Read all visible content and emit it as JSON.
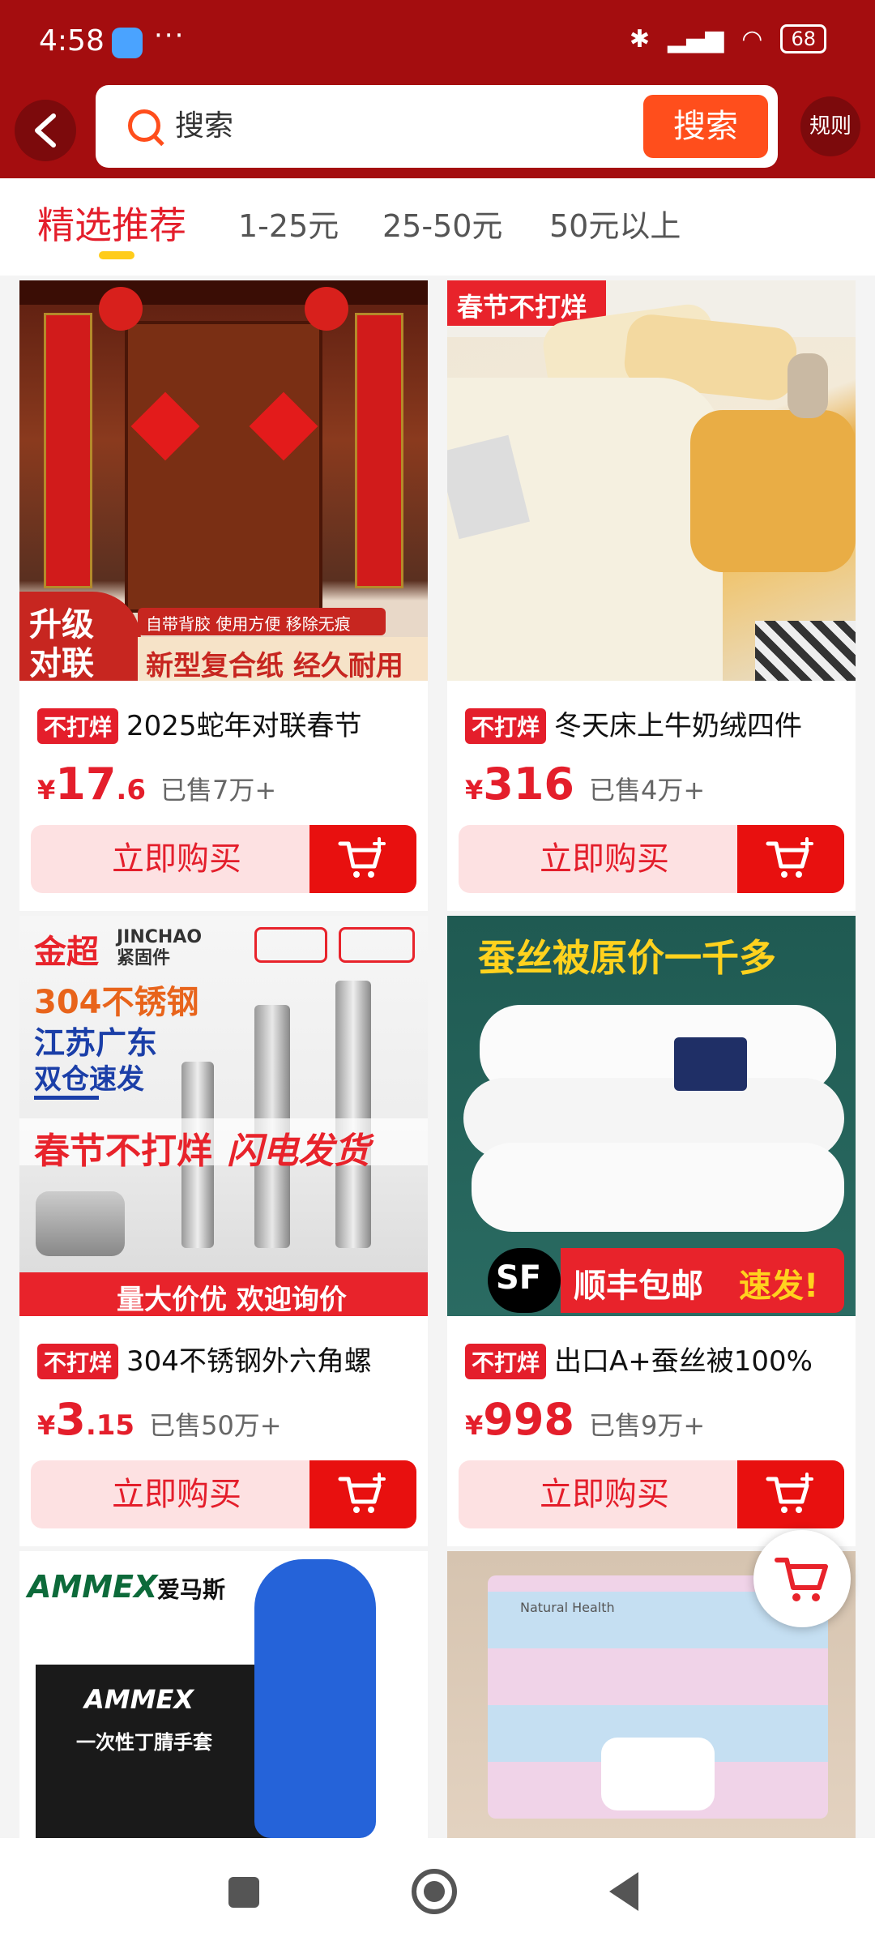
{
  "status_bar": {
    "time": "4:58",
    "dots": "···",
    "battery": "68"
  },
  "header": {
    "search_placeholder": "搜索",
    "search_button": "搜索",
    "rules_button": "规则"
  },
  "tabs": [
    {
      "label": "精选推荐",
      "active": true
    },
    {
      "label": "1-25元"
    },
    {
      "label": "25-50元"
    },
    {
      "label": "50元以上"
    }
  ],
  "products": [
    {
      "badge": "不打烊",
      "title": "2025蛇年对联春节",
      "price_symbol": "¥",
      "price_int": "17",
      "price_dec": ".6",
      "sold": "已售7万+",
      "buy_label": "立即购买",
      "image_text": {
        "a": "升级",
        "b": "对联",
        "c": "自带背胶 使用方便 移除无痕",
        "d": "新型复合纸 经久耐用"
      }
    },
    {
      "badge": "不打烊",
      "title": "冬天床上牛奶绒四件",
      "price_symbol": "¥",
      "price_int": "316",
      "price_dec": "",
      "sold": "已售4万+",
      "buy_label": "立即购买",
      "image_text": {
        "a": "春节不打烊"
      }
    },
    {
      "badge": "不打烊",
      "title": "304不锈钢外六角螺",
      "price_symbol": "¥",
      "price_int": "3",
      "price_dec": ".15",
      "sold": "已售50万+",
      "buy_label": "立即购买",
      "image_text": {
        "a": "金超",
        "b": "JINCHAO 紧固件",
        "c": "304不锈钢",
        "d": "江苏广东",
        "e": "双仓速发",
        "f": "春节不打烊",
        "g": "闪电发货",
        "h": "量大价优 欢迎询价"
      }
    },
    {
      "badge": "不打烊",
      "title": "出口A+蚕丝被100%",
      "price_symbol": "¥",
      "price_int": "998",
      "price_dec": "",
      "sold": "已售9万+",
      "buy_label": "立即购买",
      "image_text": {
        "a": "蚕丝被原价一千多",
        "b": "顺丰包邮",
        "c": "速发!"
      }
    }
  ],
  "more_products": [
    {
      "image_text": {
        "a": "AMMEX",
        "b": "爱马斯",
        "c": "一次性丁腈手套"
      }
    },
    {
      "image_text": {
        "a": "Natural Health"
      }
    }
  ],
  "colors": {
    "brand_red": "#a40d0f",
    "accent": "#e41e2b",
    "orange": "#ff4e1c"
  }
}
